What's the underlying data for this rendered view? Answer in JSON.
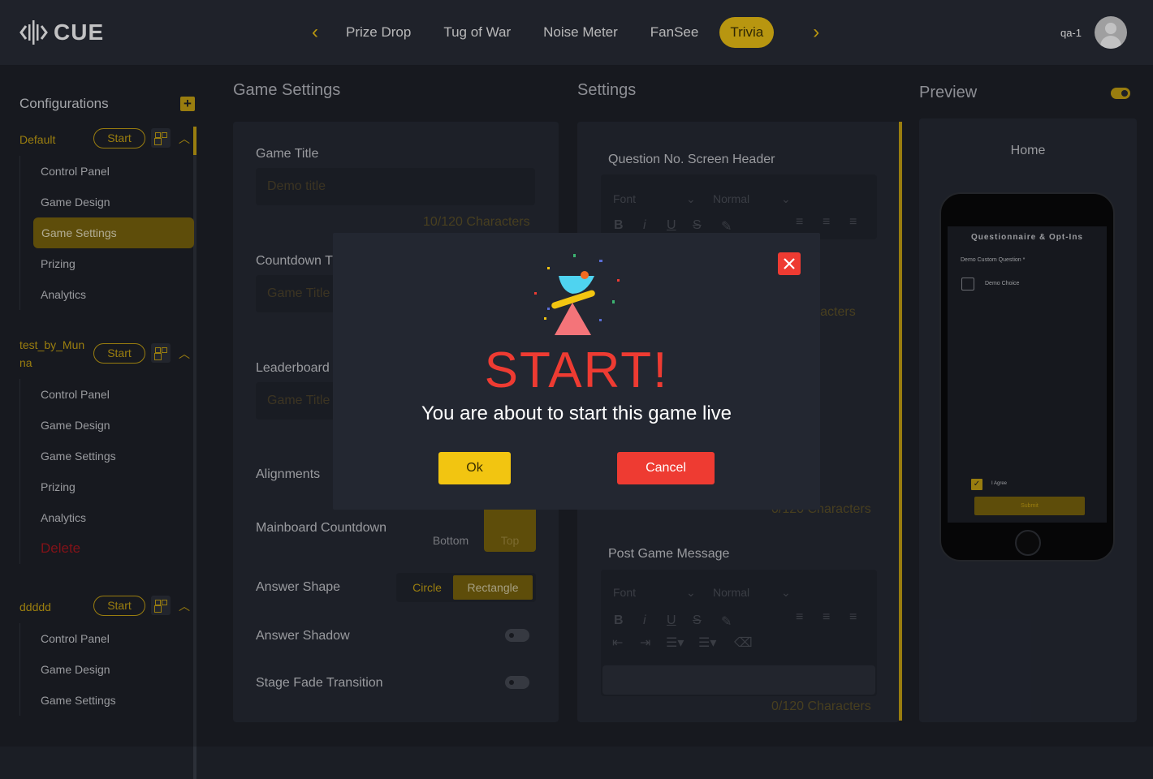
{
  "app": {
    "logo_text": "CUE"
  },
  "nav": {
    "tabs": [
      "Prize Drop",
      "Tug of War",
      "Noise Meter",
      "FanSee",
      "Trivia"
    ],
    "active": "Trivia"
  },
  "user": {
    "name": "qa-1"
  },
  "sidebar": {
    "title": "Configurations",
    "configs": [
      {
        "name": "Default",
        "start_label": "Start",
        "items": [
          "Control Panel",
          "Game Design",
          "Game Settings",
          "Prizing",
          "Analytics"
        ],
        "selected": "Game Settings"
      },
      {
        "name_line1": "test_by_Mun",
        "name_line2": "na",
        "start_label": "Start",
        "items": [
          "Control Panel",
          "Game Design",
          "Game Settings",
          "Prizing",
          "Analytics"
        ],
        "delete_label": "Delete"
      },
      {
        "name": "ddddd",
        "start_label": "Start",
        "items": [
          "Control Panel",
          "Game Design",
          "Game Settings"
        ]
      }
    ]
  },
  "game_settings": {
    "title": "Game Settings",
    "game_title_label": "Game Title",
    "game_title_placeholder": "Demo title",
    "game_title_count": "10/120 Characters",
    "countdown_label": "Countdown T",
    "countdown_placeholder": "Game Title",
    "leaderboard_label": "Leaderboard",
    "leaderboard_placeholder": "Game Title",
    "alignments_label": "Alignments",
    "mainboard_label": "Mainboard Countdown",
    "mainboard_options": [
      "Bottom",
      "Top"
    ],
    "mainboard_selected": "Top",
    "answer_shape_label": "Answer Shape",
    "answer_shape_options": [
      "Circle",
      "Rectangle"
    ],
    "answer_shape_selected": "Rectangle",
    "answer_shadow_label": "Answer Shadow",
    "stage_fade_label": "Stage Fade Transition"
  },
  "settings": {
    "title": "Settings",
    "question_header_label": "Question No. Screen Header",
    "font_placeholder": "Font",
    "size_placeholder": "Normal",
    "count_fragment_1": "haracters",
    "count_fragment_2": "0/120 Characters",
    "post_game_label": "Post Game Message",
    "post_game_count": "0/120 Characters"
  },
  "preview": {
    "title": "Preview",
    "screen_name": "Home",
    "phone": {
      "heading": "Questionnaire & Opt-Ins",
      "question": "Demo Custom Question *",
      "choice": "Demo Choice",
      "agree": "I Agree",
      "submit": "Submit"
    }
  },
  "modal": {
    "title": "START!",
    "subtitle": "You are about to start this game live",
    "ok_label": "Ok",
    "cancel_label": "Cancel"
  },
  "colors": {
    "accent": "#f2c511",
    "danger": "#ee3b32",
    "background": "#1b1e25",
    "panel": "#232731"
  }
}
